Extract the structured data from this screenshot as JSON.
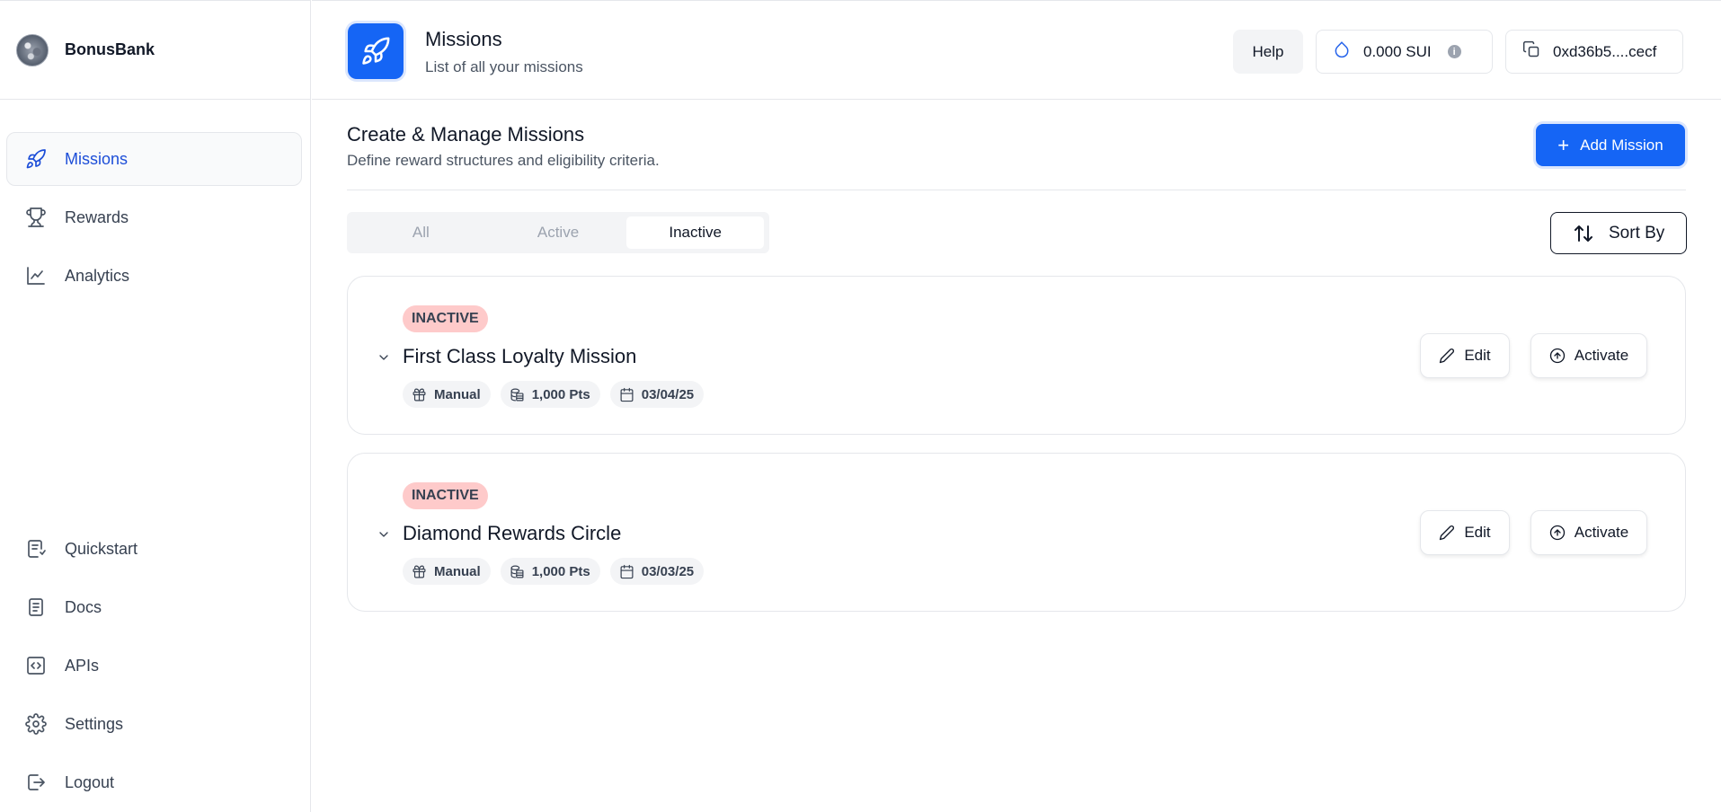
{
  "brand": {
    "name": "BonusBank"
  },
  "sidebar": {
    "top_items": [
      {
        "label": "Missions",
        "icon": "rocket-icon",
        "active": true
      },
      {
        "label": "Rewards",
        "icon": "trophy-icon",
        "active": false
      },
      {
        "label": "Analytics",
        "icon": "line-chart-icon",
        "active": false
      }
    ],
    "bottom_items": [
      {
        "label": "Quickstart",
        "icon": "quickstart-icon"
      },
      {
        "label": "Docs",
        "icon": "document-icon"
      },
      {
        "label": "APIs",
        "icon": "code-icon"
      },
      {
        "label": "Settings",
        "icon": "gear-icon"
      },
      {
        "label": "Logout",
        "icon": "logout-icon"
      }
    ]
  },
  "header": {
    "title": "Missions",
    "subtitle": "List of all your missions",
    "help_label": "Help",
    "balance": "0.000 SUI",
    "wallet": "0xd36b5....cecf"
  },
  "main": {
    "title": "Create & Manage Missions",
    "subtitle": "Define reward structures and eligibility criteria.",
    "add_label": "Add Mission",
    "tabs": [
      {
        "label": "All",
        "active": false
      },
      {
        "label": "Active",
        "active": false
      },
      {
        "label": "Inactive",
        "active": true
      }
    ],
    "sort_label": "Sort By",
    "missions": [
      {
        "status": "INACTIVE",
        "title": "First Class Loyalty Mission",
        "type": "Manual",
        "points": "1,000 Pts",
        "date": "03/04/25",
        "edit_label": "Edit",
        "activate_label": "Activate"
      },
      {
        "status": "INACTIVE",
        "title": "Diamond Rewards Circle",
        "type": "Manual",
        "points": "1,000 Pts",
        "date": "03/03/25",
        "edit_label": "Edit",
        "activate_label": "Activate"
      }
    ]
  },
  "colors": {
    "accent": "#1565f5",
    "active_nav_text": "#1d4ed8",
    "inactive_badge": "#fecaca"
  }
}
